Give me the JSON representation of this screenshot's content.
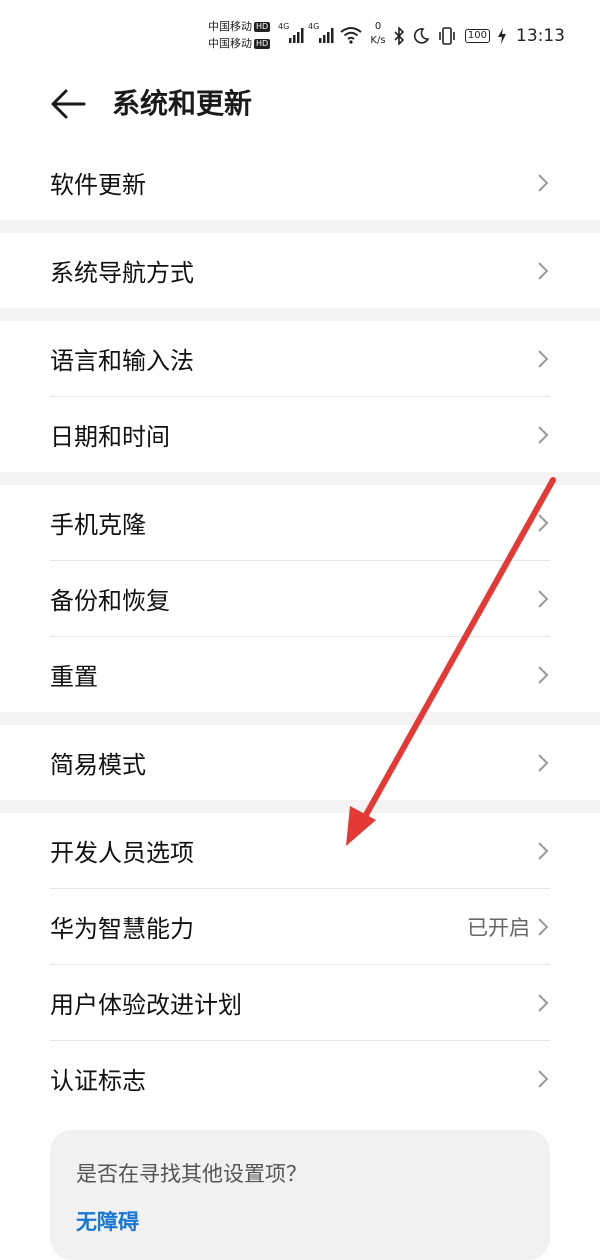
{
  "status_bar": {
    "carrier_1": "中国移动",
    "carrier_2": "中国移动",
    "hd_label": "HD",
    "network_1": "4G",
    "network_2": "4G",
    "speed_value": "0",
    "speed_unit": "K/s",
    "battery": "100",
    "time": "13:13"
  },
  "header": {
    "title": "系统和更新"
  },
  "groups": [
    {
      "items": [
        {
          "label": "软件更新",
          "value": ""
        }
      ]
    },
    {
      "items": [
        {
          "label": "系统导航方式",
          "value": ""
        }
      ]
    },
    {
      "items": [
        {
          "label": "语言和输入法",
          "value": ""
        },
        {
          "label": "日期和时间",
          "value": ""
        }
      ]
    },
    {
      "items": [
        {
          "label": "手机克隆",
          "value": ""
        },
        {
          "label": "备份和恢复",
          "value": ""
        },
        {
          "label": "重置",
          "value": ""
        }
      ]
    },
    {
      "items": [
        {
          "label": "简易模式",
          "value": ""
        }
      ]
    },
    {
      "items": [
        {
          "label": "开发人员选项",
          "value": ""
        },
        {
          "label": "华为智慧能力",
          "value": "已开启"
        },
        {
          "label": "用户体验改进计划",
          "value": ""
        },
        {
          "label": "认证标志",
          "value": ""
        }
      ]
    }
  ],
  "suggestion_card": {
    "question": "是否在寻找其他设置项？",
    "link": "无障碍"
  },
  "colors": {
    "accent_link": "#1976d2",
    "annotation_arrow": "#e53935",
    "divider": "#e6e6e6",
    "group_gap": "#f3f3f3"
  }
}
